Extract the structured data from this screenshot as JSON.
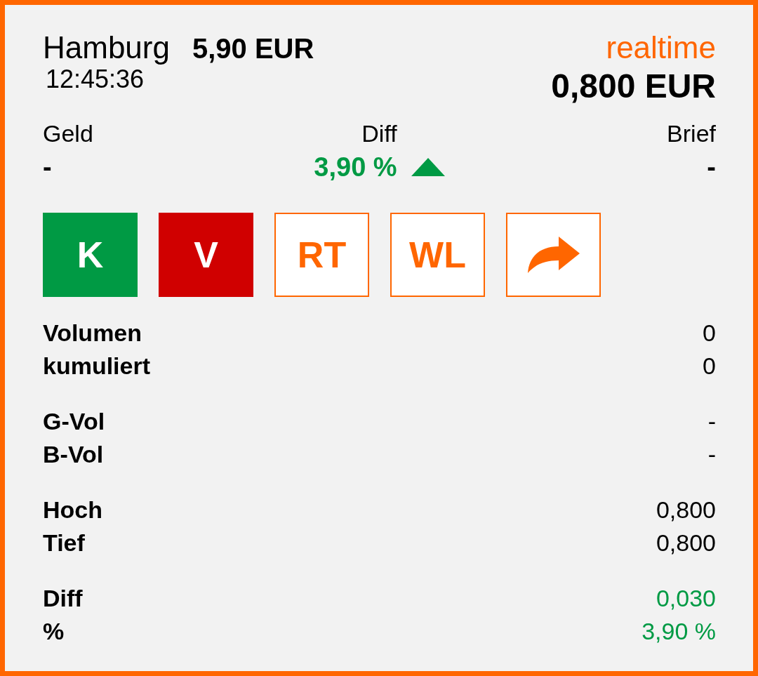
{
  "header": {
    "exchange": "Hamburg",
    "price": "5,90 EUR",
    "time": "12:45:36",
    "mode": "realtime",
    "last": "0,800 EUR"
  },
  "quote": [
    {
      "label": "Geld",
      "value": "-"
    },
    {
      "label": "Diff",
      "value": "3,90 %",
      "rising": true,
      "color": "#009a44"
    },
    {
      "label": "Brief",
      "value": "-"
    }
  ],
  "buttons": [
    {
      "kind": "buy",
      "label": "K"
    },
    {
      "kind": "sell",
      "label": "V"
    },
    {
      "kind": "outline",
      "label": "RT"
    },
    {
      "kind": "outline",
      "label": "WL"
    },
    {
      "kind": "share"
    }
  ],
  "stats": [
    [
      {
        "label": "Volumen",
        "value": "0",
        "color": "#000000"
      },
      {
        "label": "kumuliert",
        "value": "0",
        "color": "#000000"
      }
    ],
    [
      {
        "label": "G-Vol",
        "value": "-",
        "color": "#000000"
      },
      {
        "label": "B-Vol",
        "value": "-",
        "color": "#000000"
      }
    ],
    [
      {
        "label": "Hoch",
        "value": "0,800",
        "color": "#000000"
      },
      {
        "label": "Tief",
        "value": "0,800",
        "color": "#000000"
      }
    ],
    [
      {
        "label": "Diff",
        "value": "0,030",
        "color": "#009a44"
      },
      {
        "label": "%",
        "value": "3,90 %",
        "color": "#009a44"
      }
    ]
  ]
}
